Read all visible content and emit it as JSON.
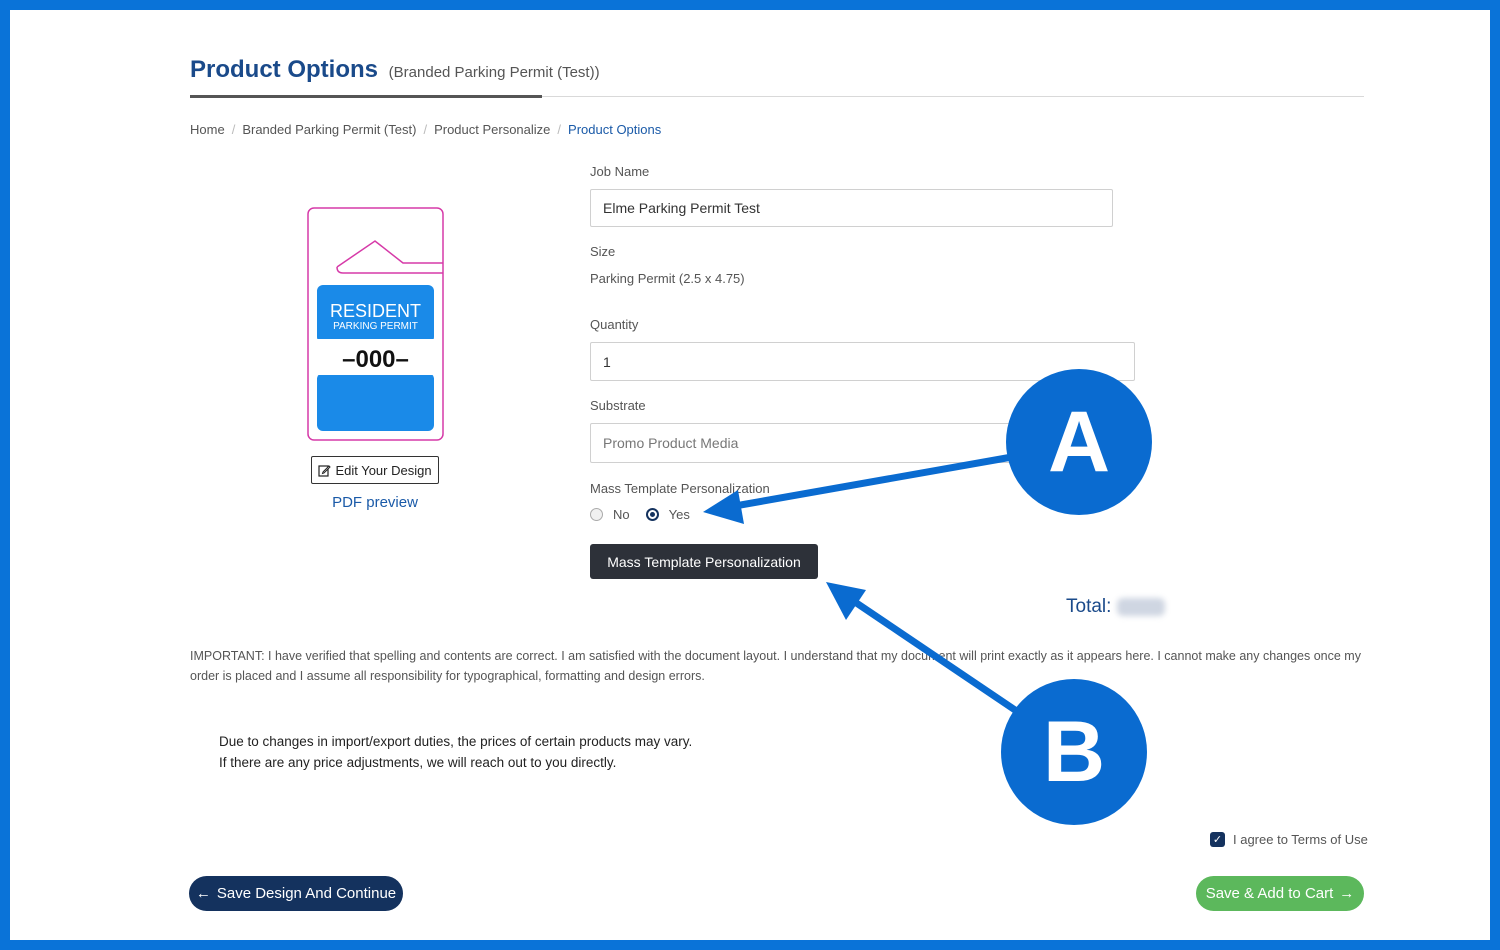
{
  "page": {
    "title": "Product Options",
    "subtitle": "(Branded Parking Permit (Test))"
  },
  "breadcrumb": {
    "items": [
      "Home",
      "Branded Parking Permit (Test)",
      "Product Personalize"
    ],
    "active": "Product Options",
    "separator": "/"
  },
  "preview": {
    "permit": {
      "line1": "RESIDENT",
      "line2": "PARKING PERMIT",
      "number": "–000–",
      "color": "#1a8ae8"
    },
    "edit_button": "Edit Your Design",
    "pdf_link": "PDF preview"
  },
  "form": {
    "job_name": {
      "label": "Job Name",
      "value": "Elme Parking Permit Test"
    },
    "size": {
      "label": "Size",
      "value": "Parking Permit (2.5 x 4.75)"
    },
    "quantity": {
      "label": "Quantity",
      "value": "1"
    },
    "substrate": {
      "label": "Substrate",
      "placeholder": "Promo Product Media"
    },
    "mass_template": {
      "label": "Mass Template Personalization",
      "options": [
        "No",
        "Yes"
      ],
      "selected": "Yes",
      "button": "Mass Template Personalization"
    }
  },
  "total": {
    "label": "Total:"
  },
  "important_text": "IMPORTANT: I have verified that spelling and contents are correct. I am satisfied with the document layout. I understand that my document will print exactly as it appears here. I cannot make any changes once my order is placed and I assume all responsibility for typographical, formatting and design errors.",
  "notice": {
    "line1": "Due to changes in import/export duties, the prices of certain products may vary.",
    "line2": "If there are any price adjustments, we will reach out to you directly."
  },
  "terms": {
    "label": "I agree to Terms of Use",
    "checked": true
  },
  "buttons": {
    "save_continue": "Save Design And Continue",
    "save_cart": "Save & Add to Cart"
  },
  "annotations": {
    "a": "A",
    "b": "B",
    "color": "#0a6bd0"
  },
  "colors": {
    "frame": "#0a73d8",
    "primary": "#14325e",
    "success": "#5cb85c"
  }
}
